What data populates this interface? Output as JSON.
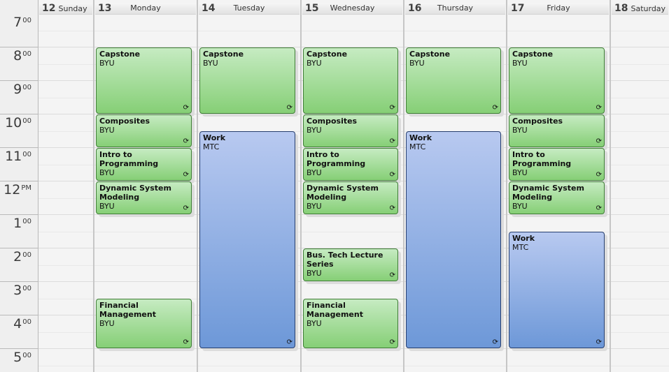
{
  "calendar": {
    "hours": [
      {
        "h": "7",
        "s": "00"
      },
      {
        "h": "8",
        "s": "00"
      },
      {
        "h": "9",
        "s": "00"
      },
      {
        "h": "10",
        "s": "00"
      },
      {
        "h": "11",
        "s": "00"
      },
      {
        "h": "12",
        "s": "PM"
      },
      {
        "h": "1",
        "s": "00"
      },
      {
        "h": "2",
        "s": "00"
      },
      {
        "h": "3",
        "s": "00"
      },
      {
        "h": "4",
        "s": "00"
      },
      {
        "h": "5",
        "s": "00"
      }
    ],
    "days": [
      {
        "num": "12",
        "name": "Sunday"
      },
      {
        "num": "13",
        "name": "Monday"
      },
      {
        "num": "14",
        "name": "Tuesday"
      },
      {
        "num": "15",
        "name": "Wednesday"
      },
      {
        "num": "16",
        "name": "Thursday"
      },
      {
        "num": "17",
        "name": "Friday"
      },
      {
        "num": "18",
        "name": "Saturday"
      }
    ],
    "recurring_icon": "recurrence-icon",
    "colors": {
      "class_event": "#a8dd9c",
      "work_event": "#93afe6"
    },
    "events": [
      {
        "day": 1,
        "start": 8,
        "end": 10,
        "title": "Capstone",
        "location": "BYU",
        "color": "green"
      },
      {
        "day": 1,
        "start": 10,
        "end": 11,
        "title": "Composites",
        "location": "BYU",
        "color": "green"
      },
      {
        "day": 1,
        "start": 11,
        "end": 12,
        "title": "Intro to Programming",
        "location": "BYU",
        "color": "green"
      },
      {
        "day": 1,
        "start": 12,
        "end": 13,
        "title": "Dynamic System Modeling",
        "location": "BYU",
        "color": "green"
      },
      {
        "day": 1,
        "start": 15.5,
        "end": 17,
        "title": "Financial Management",
        "location": "BYU",
        "color": "green"
      },
      {
        "day": 2,
        "start": 8,
        "end": 10,
        "title": "Capstone",
        "location": "BYU",
        "color": "green"
      },
      {
        "day": 2,
        "start": 10.5,
        "end": 17,
        "title": "Work",
        "location": "MTC",
        "color": "blue"
      },
      {
        "day": 3,
        "start": 8,
        "end": 10,
        "title": "Capstone",
        "location": "BYU",
        "color": "green"
      },
      {
        "day": 3,
        "start": 10,
        "end": 11,
        "title": "Composites",
        "location": "BYU",
        "color": "green"
      },
      {
        "day": 3,
        "start": 11,
        "end": 12,
        "title": "Intro to Programming",
        "location": "BYU",
        "color": "green"
      },
      {
        "day": 3,
        "start": 12,
        "end": 13,
        "title": "Dynamic System Modeling",
        "location": "BYU",
        "color": "green"
      },
      {
        "day": 3,
        "start": 14,
        "end": 15,
        "title": "Bus. Tech Lecture Series",
        "location": "BYU",
        "color": "green"
      },
      {
        "day": 3,
        "start": 15.5,
        "end": 17,
        "title": "Financial Management",
        "location": "BYU",
        "color": "green"
      },
      {
        "day": 4,
        "start": 8,
        "end": 10,
        "title": "Capstone",
        "location": "BYU",
        "color": "green"
      },
      {
        "day": 4,
        "start": 10.5,
        "end": 17,
        "title": "Work",
        "location": "MTC",
        "color": "blue"
      },
      {
        "day": 5,
        "start": 8,
        "end": 10,
        "title": "Capstone",
        "location": "BYU",
        "color": "green"
      },
      {
        "day": 5,
        "start": 10,
        "end": 11,
        "title": "Composites",
        "location": "BYU",
        "color": "green"
      },
      {
        "day": 5,
        "start": 11,
        "end": 12,
        "title": "Intro to Programming",
        "location": "BYU",
        "color": "green"
      },
      {
        "day": 5,
        "start": 12,
        "end": 13,
        "title": "Dynamic System Modeling",
        "location": "BYU",
        "color": "green"
      },
      {
        "day": 5,
        "start": 13.5,
        "end": 17,
        "title": "Work",
        "location": "MTC",
        "color": "blue"
      }
    ]
  }
}
